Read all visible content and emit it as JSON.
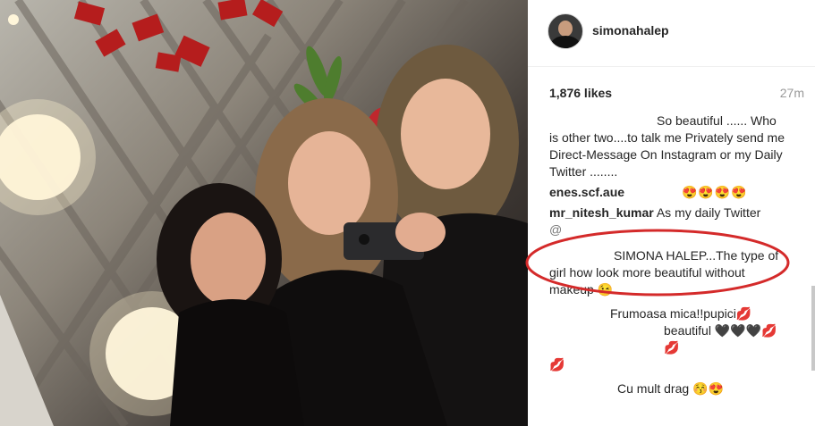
{
  "post": {
    "username": "simonahalep",
    "likes": "1,876 likes",
    "time": "27m"
  },
  "comments": [
    {
      "user": "",
      "text_line1": "So beautiful ...... Who",
      "text_rest": "is other two....to talk me Privately send me Direct-Message On Instagram or my Daily Twitter ........"
    },
    {
      "user": "enes.scf.aue",
      "text": "😍😍😍😍"
    },
    {
      "user": "mr_nitesh_kumar",
      "text": "As my daily Twitter",
      "text2": "@"
    },
    {
      "user": "",
      "text": "SIMONA HALEP...The type of girl how look more beautiful without makeup 😉"
    },
    {
      "user": "",
      "text": "Frumoasa mica!!pupici💋"
    },
    {
      "user": "",
      "text": "beautiful 🖤🖤🖤💋💋",
      "text2": "💋"
    },
    {
      "user": "",
      "text": "Cu mult drag 😚😍"
    }
  ],
  "icons": {
    "avatar": "profile-avatar",
    "highlight": "red-ellipse-annotation"
  },
  "colors": {
    "annotation": "#d42a2a",
    "username": "#262626",
    "muted": "#999999"
  }
}
